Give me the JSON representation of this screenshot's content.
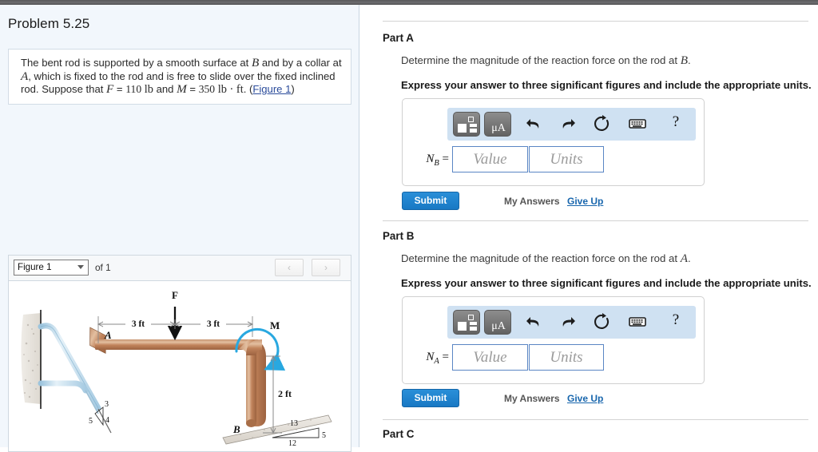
{
  "window": {
    "top_bar_color": "#5d5d60"
  },
  "left": {
    "problem_title": "Problem 5.25",
    "statement": {
      "l1_a": "The bent rod is supported by a smooth surface at ",
      "l1_var": "B",
      "l1_b": " and by a collar at",
      "l2_var": "A",
      "l2_a": ", which is fixed to the rod and is free to slide over the fixed inclined",
      "l3_a": "rod. Suppose that ",
      "l3_varF": "F",
      "l3_eq1": " = ",
      "l3_numF": "110",
      "l3_unitF": "lb",
      "l3_and": " and ",
      "l3_varM": "M",
      "l3_eq2": " = ",
      "l3_numM": "350",
      "l3_unitM": "lb · ft",
      "l3_dot": ". (",
      "l3_link": "Figure 1",
      "l3_close": ")"
    },
    "figure_bar": {
      "selected_figure": "Figure 1",
      "of_label": "of 1",
      "prev_icon": "chevron-left-icon",
      "next_icon": "chevron-right-icon",
      "prev_glyph": "‹",
      "next_glyph": "›"
    },
    "figure": {
      "force_label": "F",
      "moment_label": "M",
      "point_a": "A",
      "point_b": "B",
      "dim_left": "3 ft",
      "dim_right": "3 ft",
      "dim_vertical": "2 ft",
      "slope_left_top": "3",
      "slope_left_hyp": "5",
      "slope_left_side": "4",
      "slope_right_hyp": "13",
      "slope_right_base": "12",
      "slope_right_side": "5",
      "colors": {
        "rod": "#c08a62",
        "incline_rod": "#bcd8ea",
        "moment_arrow": "#29a8e0",
        "wall": "#e8e4df"
      }
    }
  },
  "right": {
    "toolbar": {
      "template_icon": "math-template-icon",
      "units_icon": "units-micro-angstrom-icon",
      "units_text": "μA",
      "undo_icon": "undo-arrow-icon",
      "redo_icon": "redo-arrow-icon",
      "reset_icon": "reset-circular-arrow-icon",
      "keyboard_icon": "keyboard-icon",
      "help_icon": "help-question-icon",
      "help_glyph": "?"
    },
    "buttons": {
      "submit_label": "Submit",
      "my_answers_label": "My Answers",
      "give_up_label": "Give Up"
    },
    "placeholders": {
      "value": "Value",
      "units": "Units"
    },
    "parts": [
      {
        "label": "Part A",
        "prompt_a": "Determine the magnitude of the reaction force on the rod at ",
        "prompt_var": "B",
        "prompt_b": ".",
        "instruction": "Express your answer to three significant figures and include the appropriate units.",
        "var_main": "N",
        "var_sub": "B",
        "var_eq": " =",
        "value": "",
        "units": ""
      },
      {
        "label": "Part B",
        "prompt_a": "Determine the magnitude of the reaction force on the rod at ",
        "prompt_var": "A",
        "prompt_b": ".",
        "instruction": "Express your answer to three significant figures and include the appropriate units.",
        "var_main": "N",
        "var_sub": "A",
        "var_eq": " =",
        "value": "",
        "units": ""
      },
      {
        "label": "Part C"
      }
    ]
  }
}
